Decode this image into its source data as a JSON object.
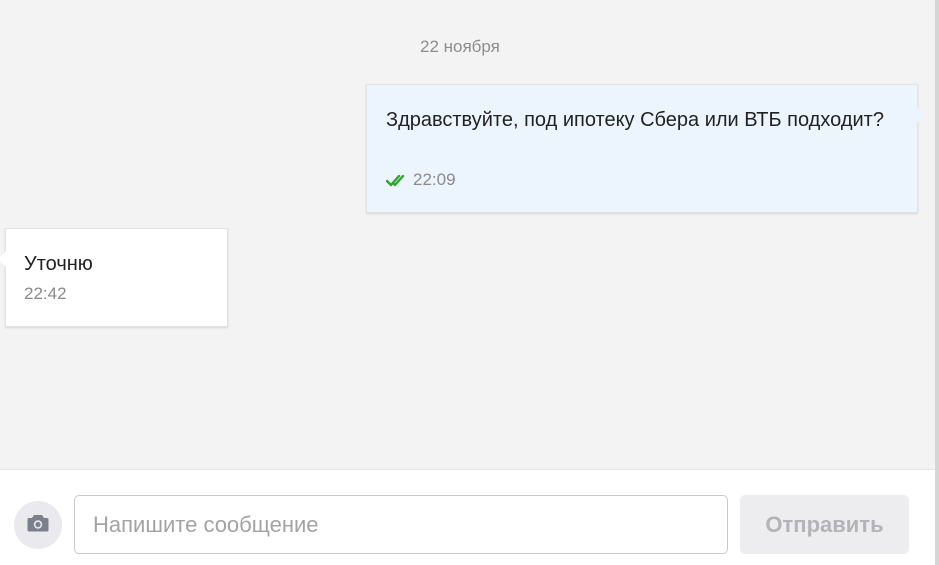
{
  "chat": {
    "date_separator": "22 ноября",
    "messages": [
      {
        "direction": "outgoing",
        "text": "Здравствуйте, под ипотеку Сбера или ВТБ подходит?",
        "time": "22:09",
        "status_icon": "double-check-icon",
        "status_color": "#2fa52f"
      },
      {
        "direction": "incoming",
        "text": "Уточню",
        "time": "22:42"
      }
    ]
  },
  "composer": {
    "attach_icon": "camera-icon",
    "input_placeholder": "Напишите сообщение",
    "input_value": "",
    "send_label": "Отправить"
  },
  "colors": {
    "chat_background": "#f3f3f3",
    "outgoing_bubble": "#ecf4fd",
    "incoming_bubble": "#ffffff",
    "read_check": "#2fa52f"
  }
}
